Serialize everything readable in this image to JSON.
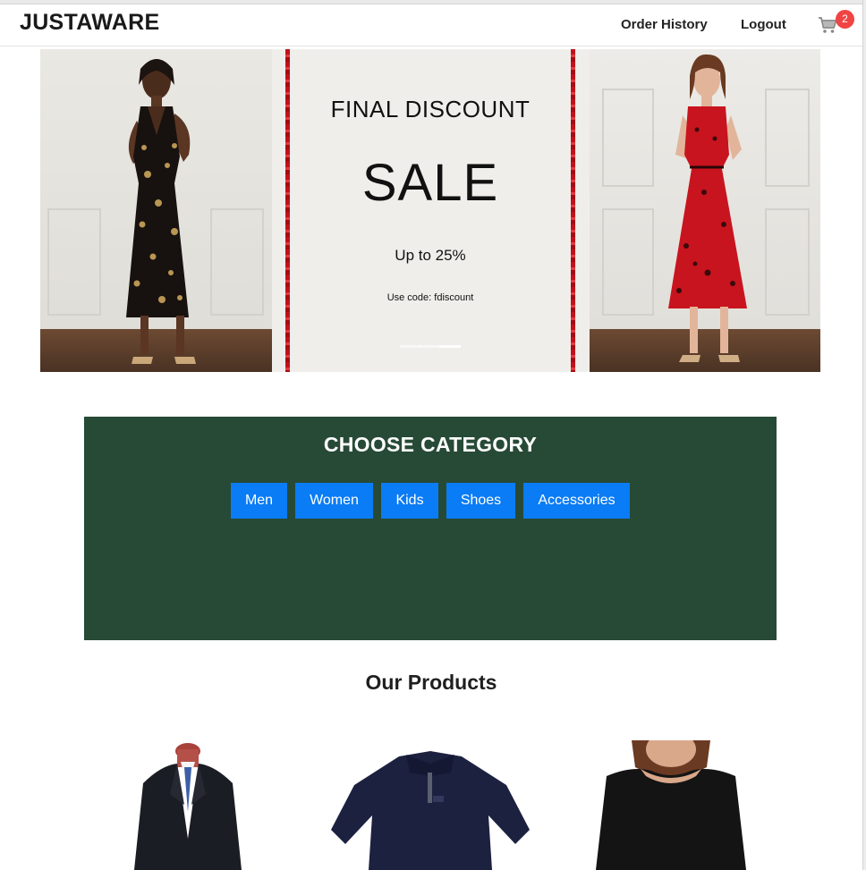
{
  "navbar": {
    "brand": "JUSTAWARE",
    "links": [
      "Order History",
      "Logout"
    ],
    "cart_icon": "cart-icon",
    "cart_count": "2"
  },
  "hero": {
    "promo_line1": "FINAL DISCOUNT",
    "promo_sale": "SALE",
    "promo_percent": "Up to 25%",
    "promo_code": "Use code: fdiscount",
    "slides_total": 3,
    "active_slide": 3
  },
  "category": {
    "title": "CHOOSE CATEGORY",
    "buttons": [
      "Men",
      "Women",
      "Kids",
      "Shoes",
      "Accessories"
    ]
  },
  "products": {
    "title": "Our Products",
    "items": [
      "suit-jacket-image",
      "polo-shirt-image",
      "black-top-image"
    ]
  },
  "colors": {
    "category_bg": "#274a36",
    "button_bg": "#0a7cf5",
    "badge_bg": "#f04444",
    "promo_stripe": "#c1121b"
  }
}
